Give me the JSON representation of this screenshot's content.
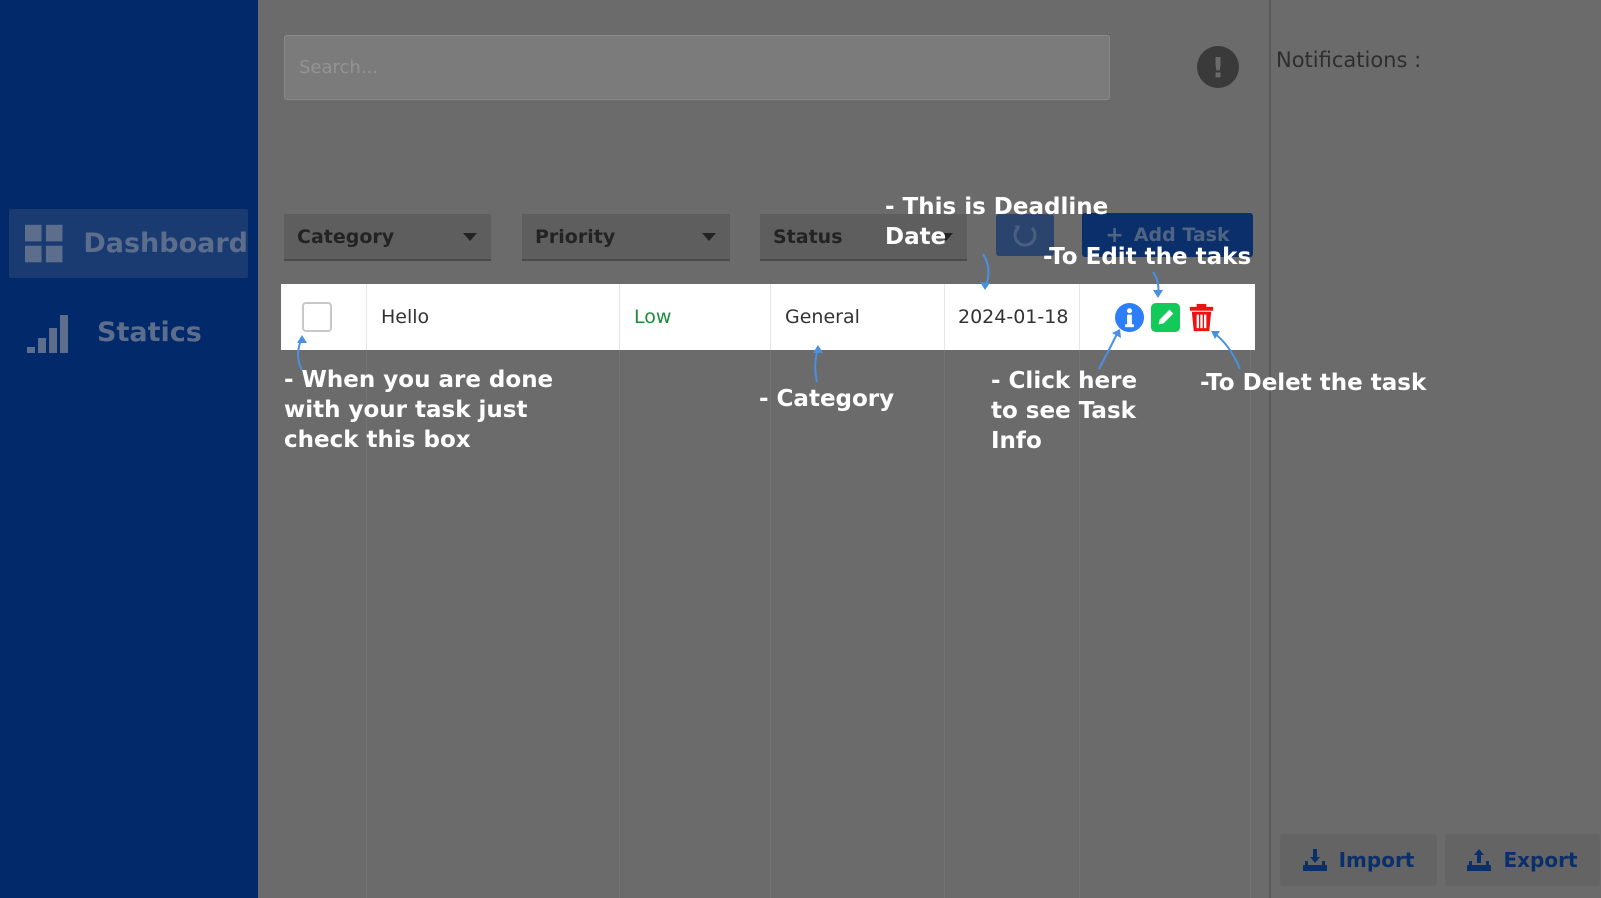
{
  "sidebar": {
    "items": [
      {
        "label": "Dashboard",
        "icon": "grid-icon",
        "active": true
      },
      {
        "label": "Statics",
        "icon": "bar-chart-icon",
        "active": false
      }
    ]
  },
  "search": {
    "placeholder": "Search..."
  },
  "filters": {
    "category": "Category",
    "priority": "Priority",
    "status": "Status"
  },
  "toolbar": {
    "add_task_label": "Add Task",
    "add_task_icon": "+"
  },
  "task": {
    "title": "Hello",
    "priority": "Low",
    "category": "General",
    "deadline": "2024-01-18",
    "priority_color": "#1e8a3c"
  },
  "notifications": {
    "title": "Notifications :"
  },
  "footer": {
    "import_label": "Import",
    "export_label": "Export"
  },
  "annotations": {
    "deadline": "- This is Deadline\nDate",
    "edit": "-To Edit the taks",
    "checkbox": "- When you are done\nwith your task just\ncheck this box",
    "category": "- Category",
    "info": "- Click here\nto see Task\nInfo",
    "delete": "-To Delet the task"
  },
  "colors": {
    "sidebar": "#022a6b",
    "overlay": "#6b6b6b",
    "info": "#2d7ff9",
    "edit": "#13c95a",
    "delete": "#ee1111",
    "annotation_arrow": "#4a90e2"
  }
}
